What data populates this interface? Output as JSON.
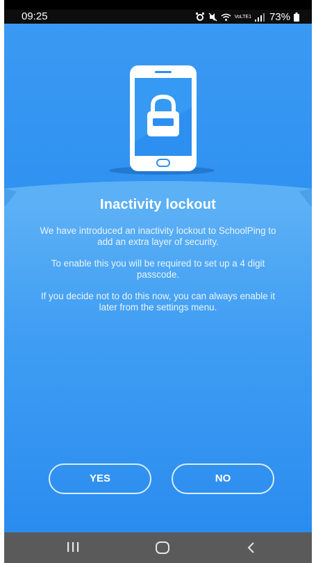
{
  "status_bar": {
    "time": "09:25",
    "network_label": "VoLTE1",
    "battery": "73%"
  },
  "icons": {
    "alarm": "alarm-icon",
    "mute": "mute-icon",
    "wifi": "wifi-icon",
    "signal": "signal-icon",
    "battery": "battery-icon",
    "lock": "lock-icon",
    "phone": "phone-illustration-icon",
    "recent_apps": "recent-apps-icon",
    "home": "home-icon",
    "back": "back-icon"
  },
  "colors": {
    "primary": "#2d8ff0",
    "accent_light": "#5cb0f5",
    "phone_screen": "#2d8ff0",
    "nav_bar": "#5a5a5a"
  },
  "dialog": {
    "title": "Inactivity lockout",
    "paragraph_1": "We have introduced an inactivity lockout to SchoolPing to add an extra layer of security.",
    "paragraph_2": "To enable this you will be required to set up a 4 digit passcode.",
    "paragraph_3": "If you decide not to do this now, you can always enable it later from the settings menu.",
    "yes_label": "YES",
    "no_label": "NO"
  }
}
